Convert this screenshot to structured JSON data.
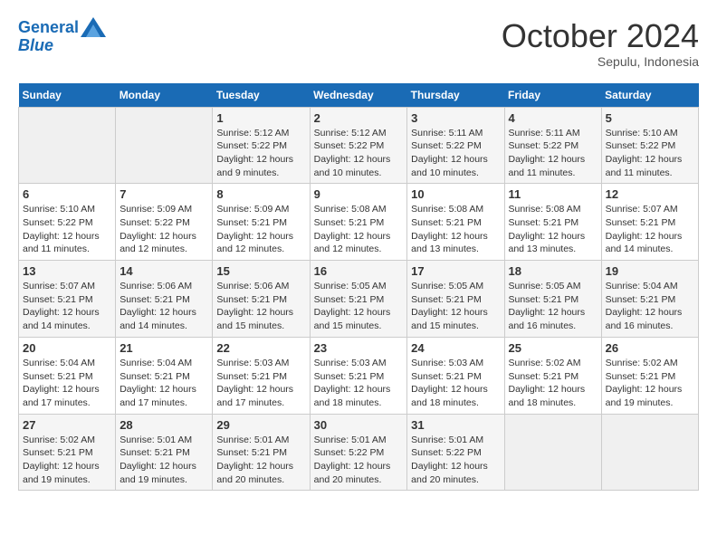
{
  "header": {
    "logo_line1": "General",
    "logo_line2": "Blue",
    "month": "October 2024",
    "location": "Sepulu, Indonesia"
  },
  "weekdays": [
    "Sunday",
    "Monday",
    "Tuesday",
    "Wednesday",
    "Thursday",
    "Friday",
    "Saturday"
  ],
  "weeks": [
    [
      {
        "day": "",
        "empty": true
      },
      {
        "day": "",
        "empty": true
      },
      {
        "day": "1",
        "sunrise": "5:12 AM",
        "sunset": "5:22 PM",
        "daylight": "12 hours and 9 minutes."
      },
      {
        "day": "2",
        "sunrise": "5:12 AM",
        "sunset": "5:22 PM",
        "daylight": "12 hours and 10 minutes."
      },
      {
        "day": "3",
        "sunrise": "5:11 AM",
        "sunset": "5:22 PM",
        "daylight": "12 hours and 10 minutes."
      },
      {
        "day": "4",
        "sunrise": "5:11 AM",
        "sunset": "5:22 PM",
        "daylight": "12 hours and 11 minutes."
      },
      {
        "day": "5",
        "sunrise": "5:10 AM",
        "sunset": "5:22 PM",
        "daylight": "12 hours and 11 minutes."
      }
    ],
    [
      {
        "day": "6",
        "sunrise": "5:10 AM",
        "sunset": "5:22 PM",
        "daylight": "12 hours and 11 minutes."
      },
      {
        "day": "7",
        "sunrise": "5:09 AM",
        "sunset": "5:22 PM",
        "daylight": "12 hours and 12 minutes."
      },
      {
        "day": "8",
        "sunrise": "5:09 AM",
        "sunset": "5:21 PM",
        "daylight": "12 hours and 12 minutes."
      },
      {
        "day": "9",
        "sunrise": "5:08 AM",
        "sunset": "5:21 PM",
        "daylight": "12 hours and 12 minutes."
      },
      {
        "day": "10",
        "sunrise": "5:08 AM",
        "sunset": "5:21 PM",
        "daylight": "12 hours and 13 minutes."
      },
      {
        "day": "11",
        "sunrise": "5:08 AM",
        "sunset": "5:21 PM",
        "daylight": "12 hours and 13 minutes."
      },
      {
        "day": "12",
        "sunrise": "5:07 AM",
        "sunset": "5:21 PM",
        "daylight": "12 hours and 14 minutes."
      }
    ],
    [
      {
        "day": "13",
        "sunrise": "5:07 AM",
        "sunset": "5:21 PM",
        "daylight": "12 hours and 14 minutes."
      },
      {
        "day": "14",
        "sunrise": "5:06 AM",
        "sunset": "5:21 PM",
        "daylight": "12 hours and 14 minutes."
      },
      {
        "day": "15",
        "sunrise": "5:06 AM",
        "sunset": "5:21 PM",
        "daylight": "12 hours and 15 minutes."
      },
      {
        "day": "16",
        "sunrise": "5:05 AM",
        "sunset": "5:21 PM",
        "daylight": "12 hours and 15 minutes."
      },
      {
        "day": "17",
        "sunrise": "5:05 AM",
        "sunset": "5:21 PM",
        "daylight": "12 hours and 15 minutes."
      },
      {
        "day": "18",
        "sunrise": "5:05 AM",
        "sunset": "5:21 PM",
        "daylight": "12 hours and 16 minutes."
      },
      {
        "day": "19",
        "sunrise": "5:04 AM",
        "sunset": "5:21 PM",
        "daylight": "12 hours and 16 minutes."
      }
    ],
    [
      {
        "day": "20",
        "sunrise": "5:04 AM",
        "sunset": "5:21 PM",
        "daylight": "12 hours and 17 minutes."
      },
      {
        "day": "21",
        "sunrise": "5:04 AM",
        "sunset": "5:21 PM",
        "daylight": "12 hours and 17 minutes."
      },
      {
        "day": "22",
        "sunrise": "5:03 AM",
        "sunset": "5:21 PM",
        "daylight": "12 hours and 17 minutes."
      },
      {
        "day": "23",
        "sunrise": "5:03 AM",
        "sunset": "5:21 PM",
        "daylight": "12 hours and 18 minutes."
      },
      {
        "day": "24",
        "sunrise": "5:03 AM",
        "sunset": "5:21 PM",
        "daylight": "12 hours and 18 minutes."
      },
      {
        "day": "25",
        "sunrise": "5:02 AM",
        "sunset": "5:21 PM",
        "daylight": "12 hours and 18 minutes."
      },
      {
        "day": "26",
        "sunrise": "5:02 AM",
        "sunset": "5:21 PM",
        "daylight": "12 hours and 19 minutes."
      }
    ],
    [
      {
        "day": "27",
        "sunrise": "5:02 AM",
        "sunset": "5:21 PM",
        "daylight": "12 hours and 19 minutes."
      },
      {
        "day": "28",
        "sunrise": "5:01 AM",
        "sunset": "5:21 PM",
        "daylight": "12 hours and 19 minutes."
      },
      {
        "day": "29",
        "sunrise": "5:01 AM",
        "sunset": "5:21 PM",
        "daylight": "12 hours and 20 minutes."
      },
      {
        "day": "30",
        "sunrise": "5:01 AM",
        "sunset": "5:22 PM",
        "daylight": "12 hours and 20 minutes."
      },
      {
        "day": "31",
        "sunrise": "5:01 AM",
        "sunset": "5:22 PM",
        "daylight": "12 hours and 20 minutes."
      },
      {
        "day": "",
        "empty": true
      },
      {
        "day": "",
        "empty": true
      }
    ]
  ],
  "labels": {
    "sunrise": "Sunrise:",
    "sunset": "Sunset:",
    "daylight": "Daylight:"
  }
}
